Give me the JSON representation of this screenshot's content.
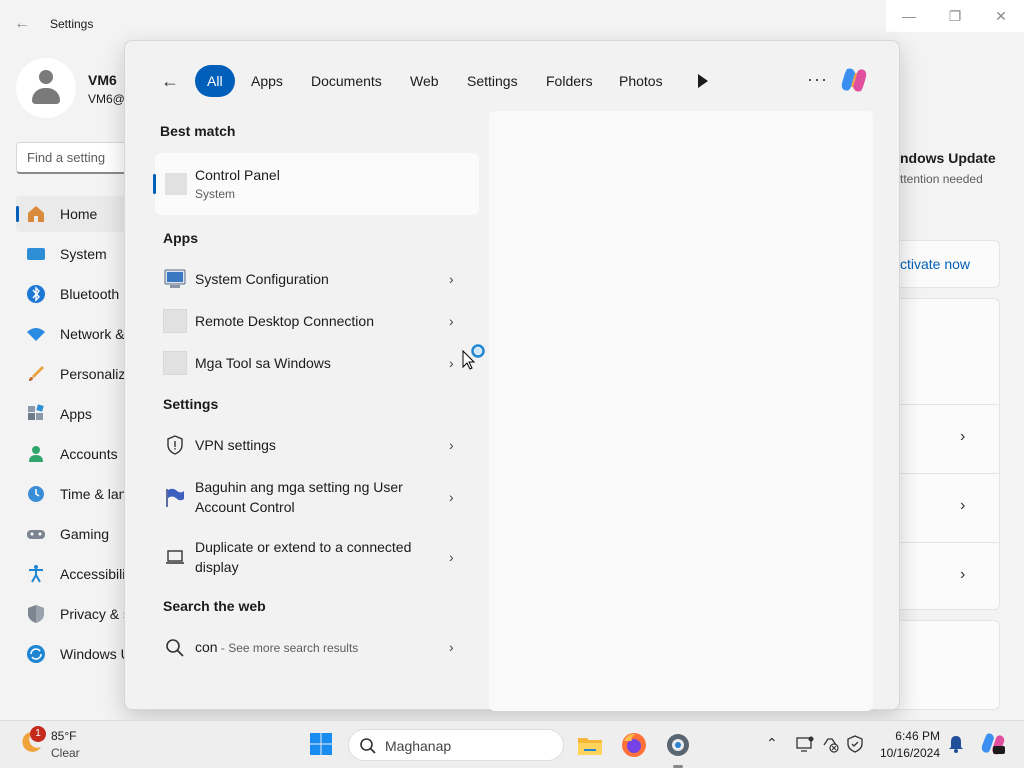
{
  "settings_window": {
    "title": "Settings",
    "back_glyph": "←",
    "controls": {
      "minimize": "—",
      "maximize": "❐",
      "close": "✕"
    },
    "profile": {
      "name": "VM6",
      "email": "VM6@"
    },
    "find_placeholder": "Find a setting",
    "nav": [
      {
        "label": "Home",
        "icon": "home-icon"
      },
      {
        "label": "System",
        "icon": "system-icon"
      },
      {
        "label": "Bluetooth",
        "icon": "bluetooth-icon"
      },
      {
        "label": "Network &",
        "icon": "network-icon"
      },
      {
        "label": "Personaliza",
        "icon": "personalization-icon"
      },
      {
        "label": "Apps",
        "icon": "apps-icon"
      },
      {
        "label": "Accounts",
        "icon": "accounts-icon"
      },
      {
        "label": "Time & lan",
        "icon": "time-language-icon"
      },
      {
        "label": "Gaming",
        "icon": "gaming-icon"
      },
      {
        "label": "Accessibili",
        "icon": "accessibility-icon"
      },
      {
        "label": "Privacy & s",
        "icon": "privacy-icon"
      },
      {
        "label": "Windows U",
        "icon": "windows-update-icon"
      }
    ],
    "right": {
      "update_title": "ndows Update",
      "update_sub": "ttention needed",
      "activate_link": "ctivate now",
      "chevron": "›"
    }
  },
  "search_flyout": {
    "back_glyph": "←",
    "tabs": [
      "All",
      "Apps",
      "Documents",
      "Web",
      "Settings",
      "Folders",
      "Photos"
    ],
    "active_tab": "All",
    "more_glyph": "···",
    "chevron": "›",
    "best_match": {
      "header": "Best match",
      "title": "Control Panel",
      "subtitle": "System"
    },
    "apps": {
      "header": "Apps",
      "items": [
        {
          "label": "System Configuration",
          "icon": "system-configuration-icon"
        },
        {
          "label": "Remote Desktop Connection",
          "icon": "app-placeholder-icon"
        },
        {
          "label": "Mga Tool sa Windows",
          "icon": "app-placeholder-icon"
        }
      ]
    },
    "settings": {
      "header": "Settings",
      "items": [
        {
          "label": "VPN settings",
          "icon": "shield-icon"
        },
        {
          "label": "Baguhin ang mga setting ng User Account Control",
          "icon": "uac-flag-icon"
        },
        {
          "label": "Duplicate or extend to a connected display",
          "icon": "laptop-display-icon"
        }
      ]
    },
    "web": {
      "header": "Search the web",
      "query": "con",
      "suffix": " - See more search results"
    }
  },
  "taskbar": {
    "weather": {
      "badge": "1",
      "temp": "85°F",
      "condition": "Clear"
    },
    "search_text": "Maghanap",
    "apps": [
      "file-explorer-icon",
      "firefox-icon",
      "settings-gear-icon"
    ],
    "tray_chevron": "⌃",
    "clock": {
      "time": "6:46 PM",
      "date": "10/16/2024"
    }
  },
  "colors": {
    "accent": "#005fb8",
    "badge": "#c42b1c"
  }
}
